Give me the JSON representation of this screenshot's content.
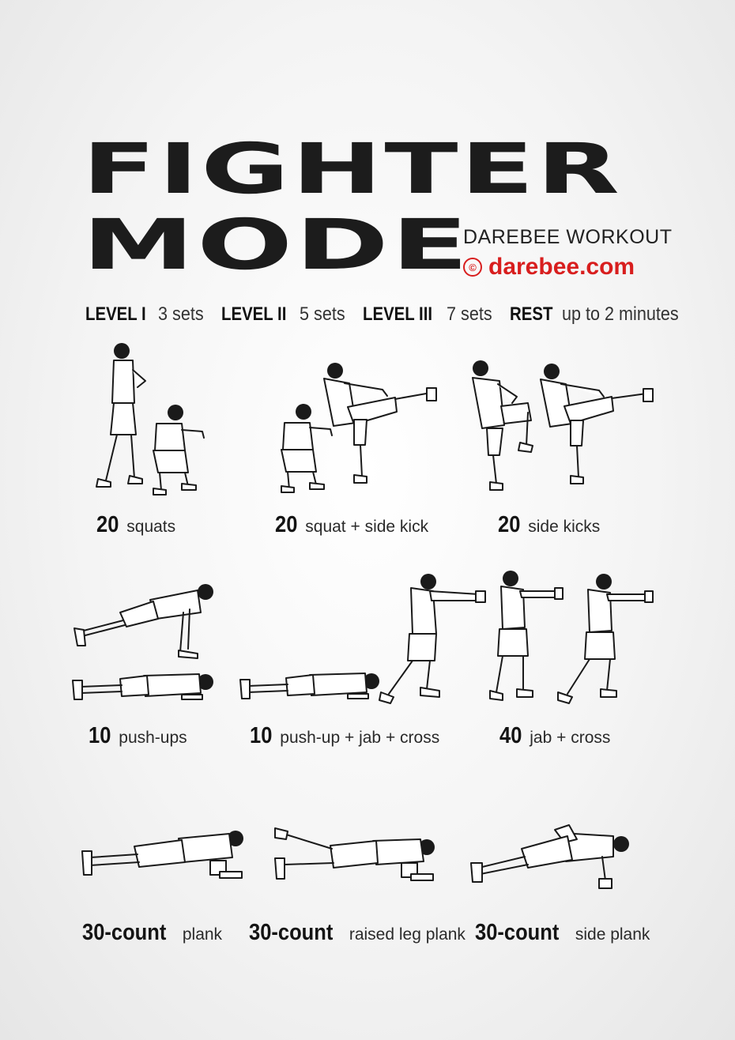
{
  "title": {
    "line1": "FIGHTER",
    "line2": "MODE"
  },
  "brand": {
    "subtitle": "DAREBEE WORKOUT",
    "copyright_symbol": "©",
    "site": "darebee.com",
    "accent_color": "#d81e1e"
  },
  "levels": [
    {
      "label": "LEVEL I",
      "value": "3 sets"
    },
    {
      "label": "LEVEL II",
      "value": "5 sets"
    },
    {
      "label": "LEVEL III",
      "value": "7 sets"
    },
    {
      "label": "REST",
      "value": "up to 2 minutes"
    }
  ],
  "exercises": [
    {
      "count": "20",
      "name": "squats"
    },
    {
      "count": "20",
      "name": "squat + side kick"
    },
    {
      "count": "20",
      "name": "side kicks"
    },
    {
      "count": "10",
      "name": "push-ups"
    },
    {
      "count": "10",
      "name": "push-up + jab + cross"
    },
    {
      "count": "40",
      "name": "jab + cross"
    },
    {
      "count": "30-count",
      "name": "plank"
    },
    {
      "count": "30-count",
      "name": "raised leg plank"
    },
    {
      "count": "30-count",
      "name": "side plank"
    }
  ]
}
